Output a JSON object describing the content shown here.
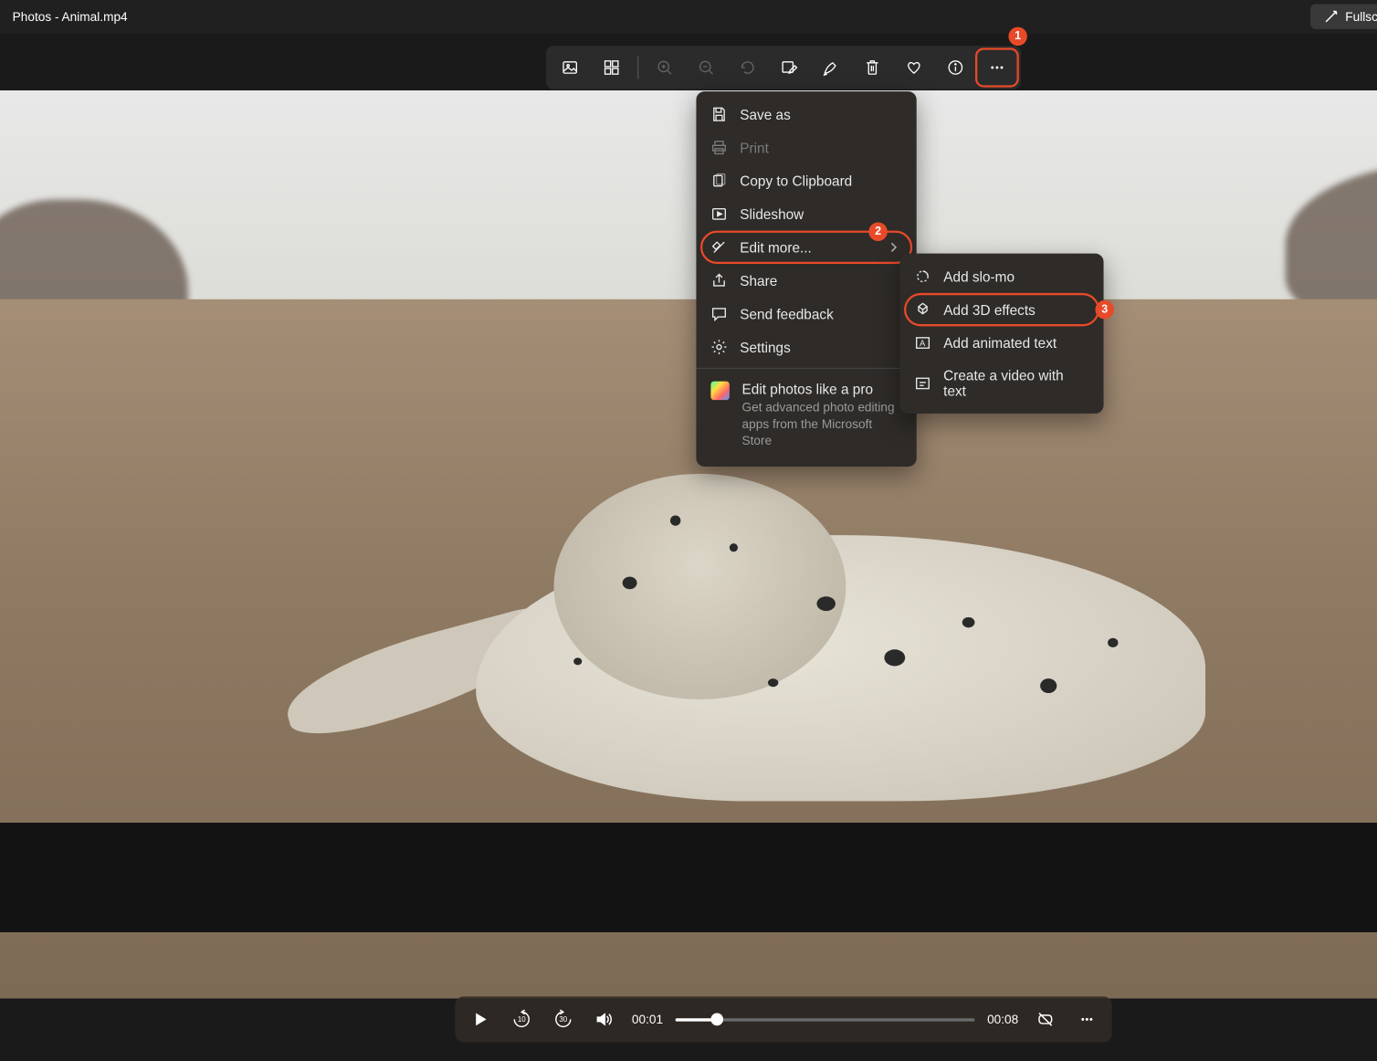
{
  "titlebar": {
    "title": "Photos - Animal.mp4",
    "fullscreen_label": "Fullscreen"
  },
  "badges": {
    "more": "1",
    "edit_more": "2",
    "add_3d": "3"
  },
  "toolbar_icons": {
    "view_photo": "view-photo-icon",
    "view_all": "view-all-icon",
    "zoom_in": "zoom-in-icon",
    "zoom_out": "zoom-out-icon",
    "rotate": "rotate-icon",
    "edit": "edit-icon",
    "draw": "draw-icon",
    "delete": "delete-icon",
    "favorite": "favorite-icon",
    "info": "info-icon",
    "more": "more-icon"
  },
  "menu": {
    "save_as": "Save as",
    "print": "Print",
    "copy": "Copy to Clipboard",
    "slideshow": "Slideshow",
    "edit_more": "Edit more...",
    "share": "Share",
    "send_feedback": "Send feedback",
    "settings": "Settings",
    "promo_title": "Edit photos like a pro",
    "promo_desc": "Get advanced photo editing apps from the Microsoft Store"
  },
  "submenu": {
    "slo_mo": "Add slo-mo",
    "effects_3d": "Add 3D effects",
    "animated_text": "Add animated text",
    "video_text": "Create a video with text"
  },
  "player": {
    "current": "00:01",
    "duration": "00:08",
    "skip_back": "10",
    "skip_fwd": "30"
  }
}
